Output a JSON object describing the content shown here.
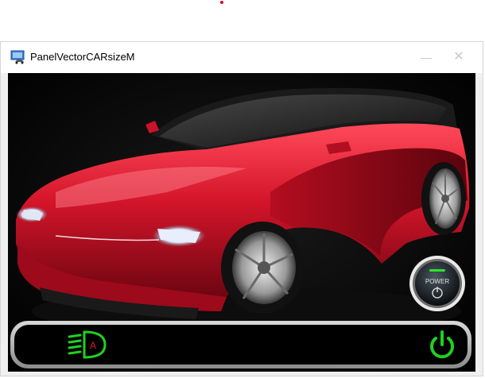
{
  "window": {
    "title": "PanelVectorCARsizeM",
    "minimize_glyph": "—",
    "close_glyph": "✕"
  },
  "power_button": {
    "label": "POWER"
  },
  "indicators": {
    "headlight": {
      "icon": "auto-headlight-icon",
      "letter": "A",
      "color": "#1fd11f"
    },
    "power": {
      "icon": "power-icon",
      "color": "#1fd11f"
    }
  },
  "colors": {
    "car_body": "#c8102e",
    "accent_green": "#1fd11f"
  }
}
